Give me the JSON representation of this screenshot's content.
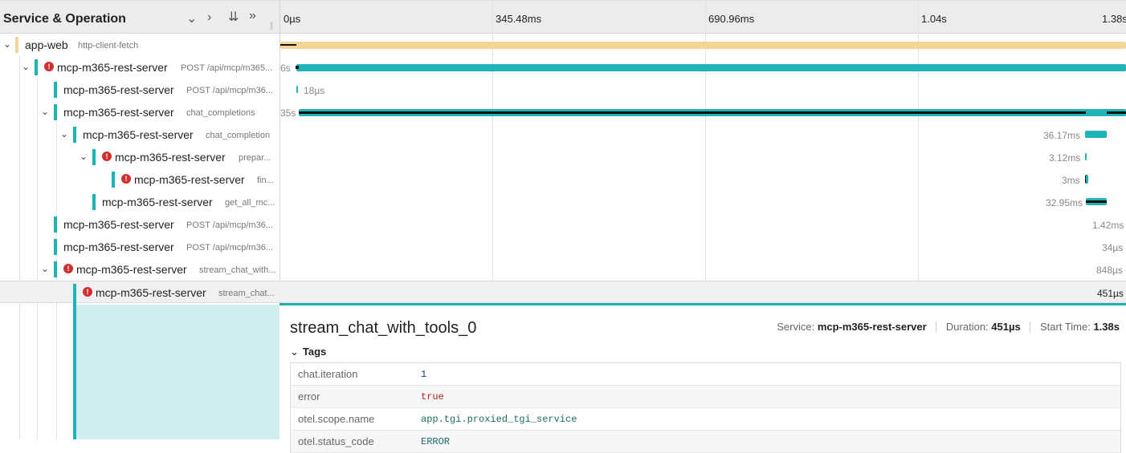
{
  "header": {
    "title": "Service & Operation",
    "ticks": [
      "0µs",
      "345.48ms",
      "690.96ms",
      "1.04s",
      "1.38s"
    ]
  },
  "colors": {
    "app_web": "#f4d596",
    "rest_server": "#1fb3b8",
    "error": "#d32f2f",
    "selected_detail": "#d2eff0"
  },
  "spans": [
    {
      "service": "app-web",
      "op": "http-client-fetch",
      "duration": ""
    },
    {
      "service": "mcp-m365-rest-server",
      "op": "POST /api/mcp/m365...",
      "duration": "6s",
      "error": true
    },
    {
      "service": "mcp-m365-rest-server",
      "op": "POST /api/mcp/m36...",
      "duration": "18µs"
    },
    {
      "service": "mcp-m365-rest-server",
      "op": "chat_completions",
      "duration": "35s"
    },
    {
      "service": "mcp-m365-rest-server",
      "op": "chat_completion",
      "duration": "36.17ms"
    },
    {
      "service": "mcp-m365-rest-server",
      "op": "prepar...",
      "duration": "3.12ms",
      "error": true
    },
    {
      "service": "mcp-m365-rest-server",
      "op": "fin...",
      "duration": "3ms",
      "error": true
    },
    {
      "service": "mcp-m365-rest-server",
      "op": "get_all_mc...",
      "duration": "32.95ms"
    },
    {
      "service": "mcp-m365-rest-server",
      "op": "POST /api/mcp/m36...",
      "duration": "1.42ms"
    },
    {
      "service": "mcp-m365-rest-server",
      "op": "POST /api/mcp/m36...",
      "duration": "34µs"
    },
    {
      "service": "mcp-m365-rest-server",
      "op": "stream_chat_with...",
      "duration": "848µs",
      "error": true
    },
    {
      "service": "mcp-m365-rest-server",
      "op": "stream_chat...",
      "duration": "451µs",
      "error": true
    }
  ],
  "detail": {
    "title": "stream_chat_with_tools_0",
    "service_label": "Service:",
    "service": "mcp-m365-rest-server",
    "duration_label": "Duration:",
    "duration": "451µs",
    "start_label": "Start Time:",
    "start": "1.38s",
    "tags_label": "Tags",
    "tags": [
      {
        "key": "chat.iteration",
        "value": "1",
        "color": "#1a3a8c"
      },
      {
        "key": "error",
        "value": "true",
        "color": "#b22222"
      },
      {
        "key": "otel.scope.name",
        "value": "app.tgi.proxied_tgi_service",
        "color": "#1a6b6b"
      },
      {
        "key": "otel.status_code",
        "value": "ERROR",
        "color": "#1a6b6b"
      }
    ]
  }
}
